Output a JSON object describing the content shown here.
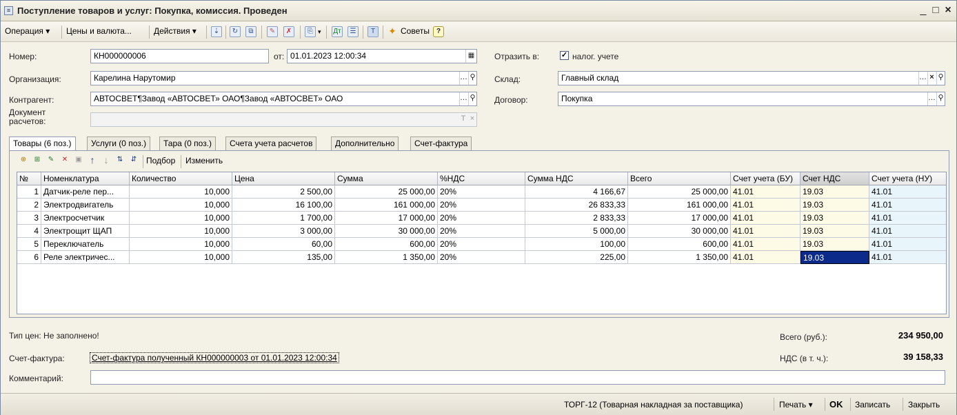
{
  "window": {
    "title": "Поступление товаров и услуг: Покупка, комиссия. Проведен",
    "controls": [
      "_",
      "□",
      "×"
    ]
  },
  "toolbar": {
    "operation_label": "Операция",
    "prices_label": "Цены и валюта...",
    "actions_label": "Действия",
    "tips_label": "Советы",
    "help_label": "?"
  },
  "header": {
    "number_label": "Номер:",
    "number_value": "КН000000006",
    "from_label": "от:",
    "date_value": "01.01.2023 12:00:34",
    "reflect_label": "Отразить в:",
    "tax_accounting_label": "налог. учете",
    "tax_accounting_checked": true,
    "org_label": "Организация:",
    "org_value": "Карелина Нарутомир",
    "warehouse_label": "Склад:",
    "warehouse_value": "Главный склад",
    "counterparty_label": "Контрагент:",
    "counterparty_value": "АВТОСВЕТ¶Завод «АВТОСВЕТ» ОАО¶Завод «АВТОСВЕТ» ОАО",
    "contract_label": "Договор:",
    "contract_value": "Покупка",
    "settlement_doc_label_1": "Документ",
    "settlement_doc_label_2": "расчетов:",
    "settlement_doc_value": ""
  },
  "tabs": [
    {
      "label": "Товары (6 поз.)",
      "active": true
    },
    {
      "label": "Услуги (0 поз.)",
      "active": false
    },
    {
      "label": "Тара (0 поз.)",
      "active": false
    },
    {
      "label": "Счета учета расчетов",
      "active": false
    },
    {
      "label": "Дополнительно",
      "active": false
    },
    {
      "label": "Счет-фактура",
      "active": false
    }
  ],
  "grid_toolbar": {
    "selection_label": "Подбор",
    "change_label": "Изменить"
  },
  "table": {
    "columns": [
      "№",
      "Номенклатура",
      "Количество",
      "Цена",
      "Сумма",
      "%НДС",
      "Сумма НДС",
      "Всего",
      "Счет учета (БУ)",
      "Счет НДС",
      "Счет учета (НУ)"
    ],
    "rows": [
      [
        "1",
        "Датчик-реле пер...",
        "10,000",
        "2 500,00",
        "25 000,00",
        "20%",
        "4 166,67",
        "25 000,00",
        "41.01",
        "19.03",
        "41.01"
      ],
      [
        "2",
        "Электродвигатель",
        "10,000",
        "16 100,00",
        "161 000,00",
        "20%",
        "26 833,33",
        "161 000,00",
        "41.01",
        "19.03",
        "41.01"
      ],
      [
        "3",
        "Электросчетчик",
        "10,000",
        "1 700,00",
        "17 000,00",
        "20%",
        "2 833,33",
        "17 000,00",
        "41.01",
        "19.03",
        "41.01"
      ],
      [
        "4",
        "Электрощит ЩАП",
        "10,000",
        "3 000,00",
        "30 000,00",
        "20%",
        "5 000,00",
        "30 000,00",
        "41.01",
        "19.03",
        "41.01"
      ],
      [
        "5",
        "Переключатель",
        "10,000",
        "60,00",
        "600,00",
        "20%",
        "100,00",
        "600,00",
        "41.01",
        "19.03",
        "41.01"
      ],
      [
        "6",
        "Реле электричес...",
        "10,000",
        "135,00",
        "1 350,00",
        "20%",
        "225,00",
        "1 350,00",
        "41.01",
        "19.03",
        "41.01"
      ]
    ]
  },
  "footer": {
    "price_type_text": "Тип цен: Не заполнено!",
    "total_label": "Всего (руб.):",
    "total_value": "234 950,00",
    "invoice_label": "Счет-фактура:",
    "invoice_link": "Счет-фактура полученный КН000000003 от 01.01.2023 12:00:34",
    "vat_label": "НДС (в т. ч.):",
    "vat_value": "39 158,33",
    "comment_label": "Комментарий:",
    "comment_value": ""
  },
  "bottombar": {
    "torg_label": "ТОРГ-12 (Товарная накладная за поставщика)",
    "print_label": "Печать",
    "ok_label": "OK",
    "save_label": "Записать",
    "close_label": "Закрыть"
  }
}
